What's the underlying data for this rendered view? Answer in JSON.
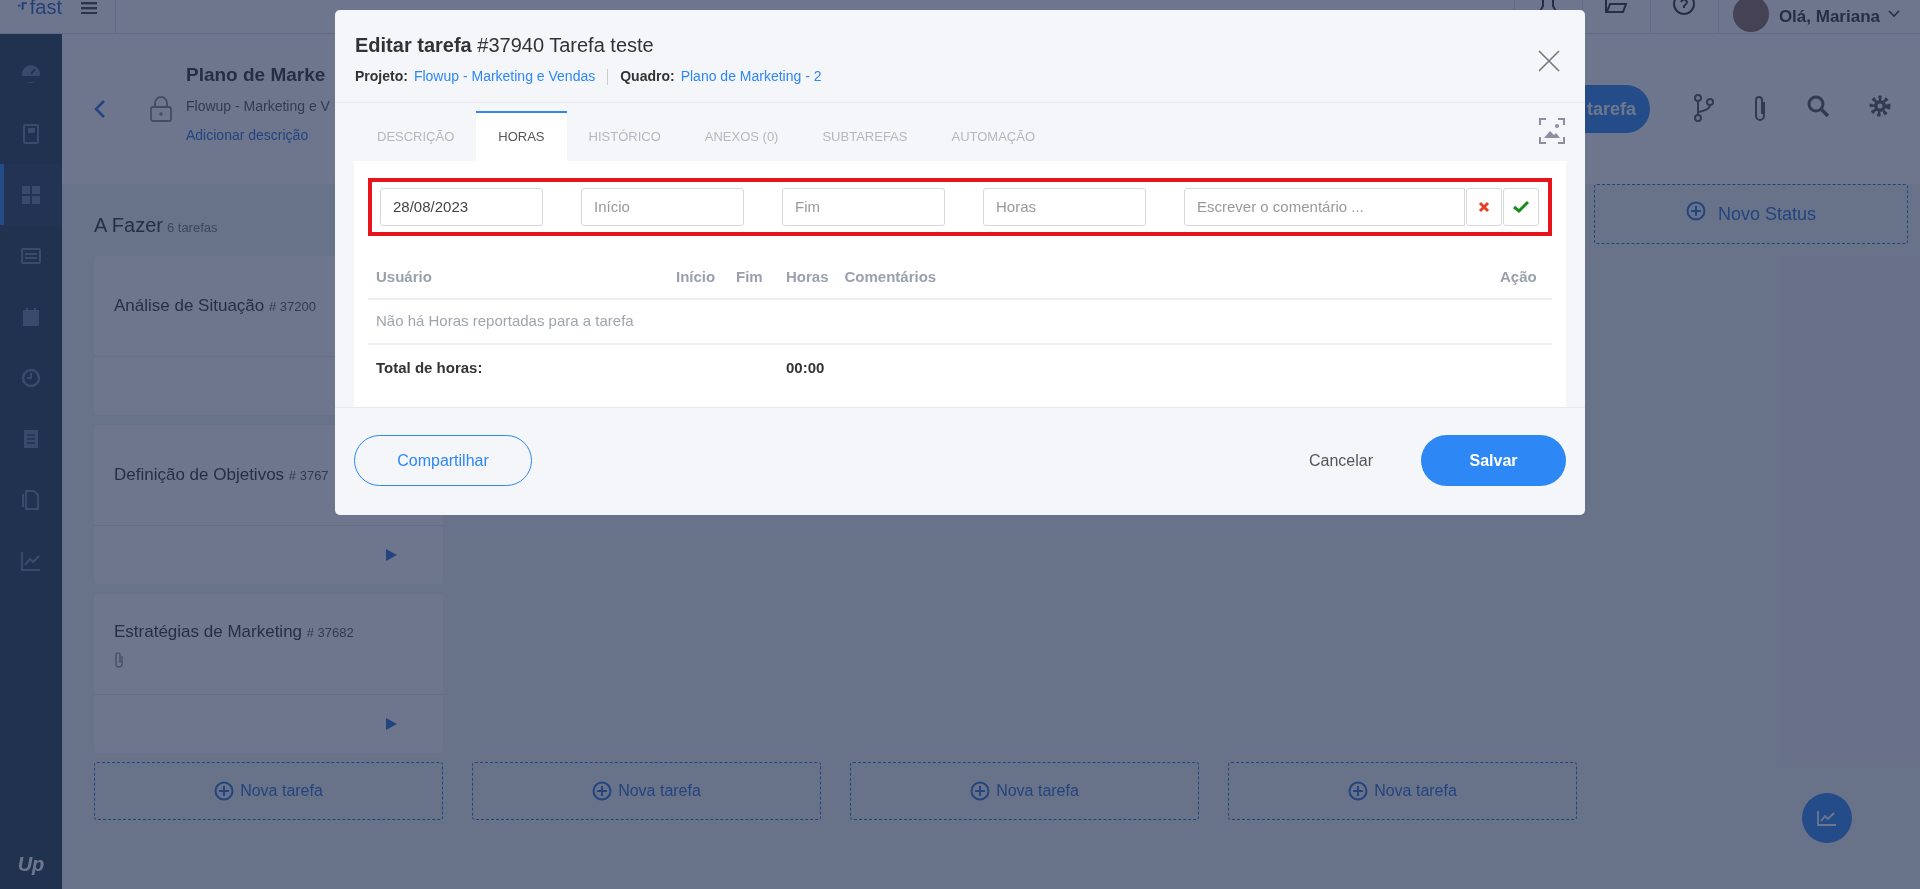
{
  "topbar": {
    "logo": "fast",
    "greeting": "Olá, Mariana"
  },
  "sidebar": {
    "items": [
      {
        "selected": false
      },
      {
        "selected": false
      },
      {
        "selected": true
      },
      {
        "selected": false
      },
      {
        "selected": false
      },
      {
        "selected": false
      },
      {
        "selected": false
      },
      {
        "selected": false
      },
      {
        "selected": false
      }
    ],
    "logo": "Up"
  },
  "board_header": {
    "title": "Plano de Marke",
    "project": "Flowup - Marketing e V",
    "add_description": "Adicionar descrição",
    "new_task_button": "tarefa"
  },
  "column": {
    "title": "A Fazer",
    "count": "6 tarefas",
    "cards": [
      {
        "title": "Análise de Situação",
        "number": "# 37200",
        "attachment": false,
        "play_button": false
      },
      {
        "title": "Definição de Objetivos",
        "number": "# 3767",
        "attachment": false,
        "play_button": true
      },
      {
        "title": "Estratégias de Marketing",
        "number": "# 37682",
        "attachment": true,
        "play_button": true
      }
    ]
  },
  "new_task_buttons": [
    "Nova tarefa",
    "Nova tarefa",
    "Nova tarefa",
    "Nova tarefa"
  ],
  "new_status": "Novo Status",
  "modal": {
    "title_bold": "Editar tarefa",
    "title": "#37940 Tarefa teste",
    "project_label": "Projeto:",
    "project": "Flowup - Marketing e Vendas",
    "board_label": "Quadro:",
    "board": "Plano de Marketing - 2",
    "tabs": [
      {
        "label": "DESCRIÇÃO",
        "selected": false
      },
      {
        "label": "HORAS",
        "selected": true
      },
      {
        "label": "HISTÓRICO",
        "selected": false
      },
      {
        "label": "ANEXOS (0)",
        "selected": false
      },
      {
        "label": "SUBTAREFAS",
        "selected": false
      },
      {
        "label": "AUTOMAÇÃO",
        "selected": false
      }
    ],
    "entry": {
      "date": {
        "value": "28/08/2023"
      },
      "start": {
        "placeholder": "Início"
      },
      "end": {
        "placeholder": "Fim"
      },
      "hours": {
        "placeholder": "Horas"
      },
      "comment": {
        "placeholder": "Escrever o comentário ..."
      }
    },
    "table": {
      "columns": [
        "Usuário",
        "Início",
        "Fim",
        "Horas",
        "Comentários",
        "Ação"
      ],
      "empty": "Não há Horas reportadas para a tarefa",
      "total_label": "Total de horas:",
      "total": "00:00"
    },
    "share": "Compartilhar",
    "cancel": "Cancelar",
    "save": "Salvar"
  }
}
